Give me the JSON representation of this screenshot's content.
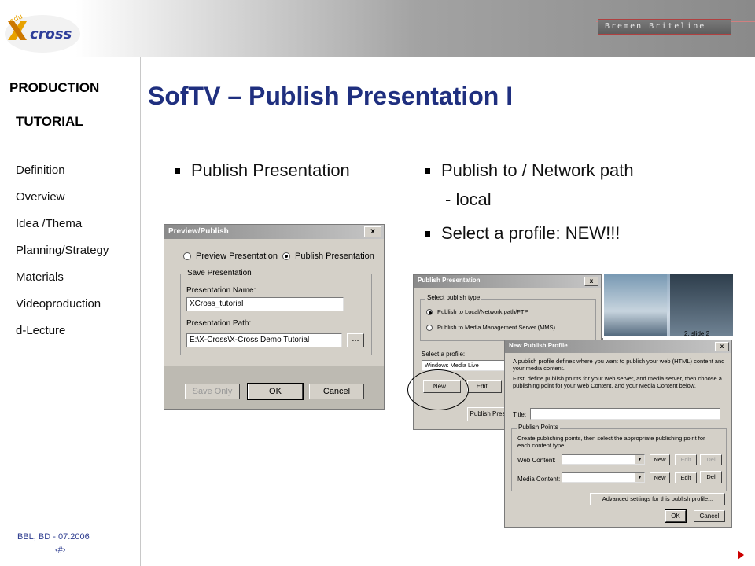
{
  "header": {
    "logo_text": "x-cross",
    "brand": "Bremen Briteline"
  },
  "sidebar": {
    "heading_1": "PRODUCTION",
    "heading_2": "TUTORIAL",
    "items": [
      {
        "label": "Definition"
      },
      {
        "label": "Overview"
      },
      {
        "label": "Idea /Thema"
      },
      {
        "label": "Planning/Strategy"
      },
      {
        "label": "Materials"
      },
      {
        "label": "Videoproduction"
      },
      {
        "label": "d-Lecture"
      }
    ],
    "footer": "BBL, BD - 07.2006",
    "page_number": "‹#›"
  },
  "slide": {
    "title": "SofTV – Publish Presentation I",
    "bullets_left": [
      "Publish Presentation"
    ],
    "bullets_right": {
      "first": "Publish to / Network path",
      "first_sub": "- local",
      "second": "Select a profile: NEW!!!"
    }
  },
  "preview_dialog": {
    "title": "Preview/Publish",
    "close": "x",
    "radio_preview": "Preview Presentation",
    "radio_publish": "Publish Presentation",
    "group_label": "Save Presentation",
    "name_label": "Presentation Name:",
    "name_value": "XCross_tutorial",
    "path_label": "Presentation Path:",
    "path_value": "E:\\X-Cross\\X-Cross Demo Tutorial",
    "browse": "...",
    "save_only": "Save Only",
    "ok": "OK",
    "cancel": "Cancel"
  },
  "publish_dialog": {
    "title": "Publish Presentation",
    "close": "x",
    "group_label": "Select publish type",
    "radio_local": "Publish to Local/Network path/FTP",
    "radio_mms": "Publish to Media Management Server (MMS)",
    "profile_label": "Select a profile:",
    "profile_value": "Windows Media Live",
    "new": "New...",
    "edit": "Edit...",
    "publish": "Publish Pres"
  },
  "photo": {
    "caption": "2. slide 2"
  },
  "profile_dialog": {
    "title": "New Publish Profile",
    "close": "x",
    "desc_1": "A publish profile defines where you want to publish your web (HTML) content and your media content.",
    "desc_2": "First, define publish points for your web server, and media server, then choose a publishing point for your Web Content, and your Media Content below.",
    "title_label": "Title:",
    "points_label": "Publish Points",
    "points_desc": "Create publishing points, then select the appropriate publishing point for each content type.",
    "web_label": "Web Content:",
    "media_label": "Media Content:",
    "new": "New",
    "edit": "Edit",
    "del": "Del",
    "advanced": "Advanced settings for this publish profile...",
    "ok": "OK",
    "cancel": "Cancel"
  }
}
